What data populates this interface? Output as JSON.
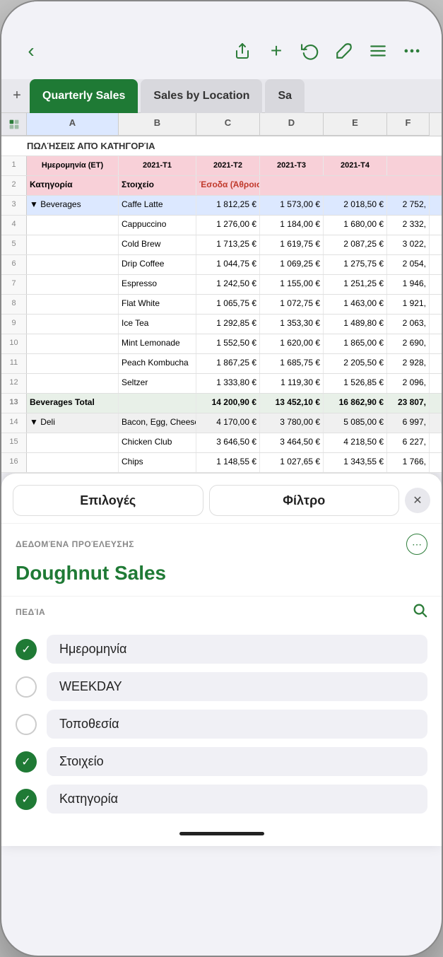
{
  "topBar": {
    "backLabel": "‹",
    "shareIcon": "⬆",
    "addIcon": "+",
    "undoIcon": "↩",
    "brushIcon": "🖌",
    "menuIcon": "≡",
    "moreIcon": "⋯"
  },
  "tabs": [
    {
      "id": "quarterly-sales",
      "label": "Quarterly Sales",
      "active": true
    },
    {
      "id": "sales-by-location",
      "label": "Sales by Location",
      "active": false
    },
    {
      "id": "partial",
      "label": "Sa",
      "active": false
    }
  ],
  "tabAddLabel": "+",
  "spreadsheet": {
    "sectionTitle": "ΠΩΛΉΣΕΙΣ ΑΠΌ ΚΑΤΗΓΟΡΊΑ",
    "columns": [
      "A",
      "B",
      "C",
      "D",
      "E",
      "F"
    ],
    "headerRow": {
      "rowNum": "1",
      "cells": [
        "Ημερομηνία (ΕΤ)",
        "2021-T1",
        "2021-T2",
        "2021-T3",
        "2021-T4"
      ]
    },
    "colLabelsRow": {
      "rowNum": "2",
      "cells": [
        "Κατηγορία",
        "Στοιχείο",
        "Έσοδα (Άθροισμα)",
        "",
        "",
        ""
      ]
    },
    "dataRows": [
      {
        "rowNum": "3",
        "selected": true,
        "cells": [
          "▼ Beverages",
          "Caffe Latte",
          "1 812,25 €",
          "1 573,00 €",
          "2 018,50 €",
          "2 752,"
        ]
      },
      {
        "rowNum": "4",
        "cells": [
          "",
          "Cappuccino",
          "1 276,00 €",
          "1 184,00 €",
          "1 680,00 €",
          "2 332,"
        ]
      },
      {
        "rowNum": "5",
        "cells": [
          "",
          "Cold Brew",
          "1 713,25 €",
          "1 619,75 €",
          "2 087,25 €",
          "3 022,"
        ]
      },
      {
        "rowNum": "6",
        "cells": [
          "",
          "Drip Coffee",
          "1 044,75 €",
          "1 069,25 €",
          "1 275,75 €",
          "2 054,"
        ]
      },
      {
        "rowNum": "7",
        "cells": [
          "",
          "Espresso",
          "1 242,50 €",
          "1 155,00 €",
          "1 251,25 €",
          "1 946,"
        ]
      },
      {
        "rowNum": "8",
        "cells": [
          "",
          "Flat White",
          "1 065,75 €",
          "1 072,75 €",
          "1 463,00 €",
          "1 921,"
        ]
      },
      {
        "rowNum": "9",
        "cells": [
          "",
          "Ice Tea",
          "1 292,85 €",
          "1 353,30 €",
          "1 489,80 €",
          "2 063,"
        ]
      },
      {
        "rowNum": "10",
        "cells": [
          "",
          "Mint Lemonade",
          "1 552,50 €",
          "1 620,00 €",
          "1 865,00 €",
          "2 690,"
        ]
      },
      {
        "rowNum": "11",
        "cells": [
          "",
          "Peach Kombucha",
          "1 867,25 €",
          "1 685,75 €",
          "2 205,50 €",
          "2 928,"
        ]
      },
      {
        "rowNum": "12",
        "cells": [
          "",
          "Seltzer",
          "1 333,80 €",
          "1 119,30 €",
          "1 526,85 €",
          "2 096,"
        ]
      },
      {
        "rowNum": "13",
        "isTotal": true,
        "cells": [
          "Beverages Total",
          "",
          "14 200,90 €",
          "13 452,10 €",
          "16 862,90 €",
          "23 807,"
        ]
      },
      {
        "rowNum": "14",
        "isCategory": true,
        "cells": [
          "▼ Deli",
          "Bacon, Egg, Cheese",
          "4 170,00 €",
          "3 780,00 €",
          "5 085,00 €",
          "6 997,"
        ]
      },
      {
        "rowNum": "15",
        "cells": [
          "",
          "Chicken Club",
          "3 646,50 €",
          "3 464,50 €",
          "4 218,50 €",
          "6 227,"
        ]
      },
      {
        "rowNum": "16",
        "cells": [
          "",
          "Chips",
          "1 148,55 €",
          "1 027,65 €",
          "1 343,55 €",
          "1 766,"
        ]
      }
    ]
  },
  "panel": {
    "tab1": "Επιλογές",
    "tab2": "Φίλτρο",
    "closeLabel": "✕",
    "sourceLabel": "ΔΕΔΟΜΈΝΑ ΠΡΟΈΛΕΥΣΗΣ",
    "moreLabel": "⋯",
    "sourceName": "Doughnut Sales",
    "fieldsLabel": "ΠΕΔΊΑ",
    "searchLabel": "🔍",
    "fields": [
      {
        "id": "imerominia",
        "label": "Ημερομηνία",
        "checked": true
      },
      {
        "id": "weekday",
        "label": "WEEKDAY",
        "checked": false
      },
      {
        "id": "topothesia",
        "label": "Τοποθεσία",
        "checked": false
      },
      {
        "id": "stoixeio",
        "label": "Στοιχείο",
        "checked": true
      },
      {
        "id": "katigoria",
        "label": "Κατηγορία",
        "checked": true
      }
    ]
  }
}
